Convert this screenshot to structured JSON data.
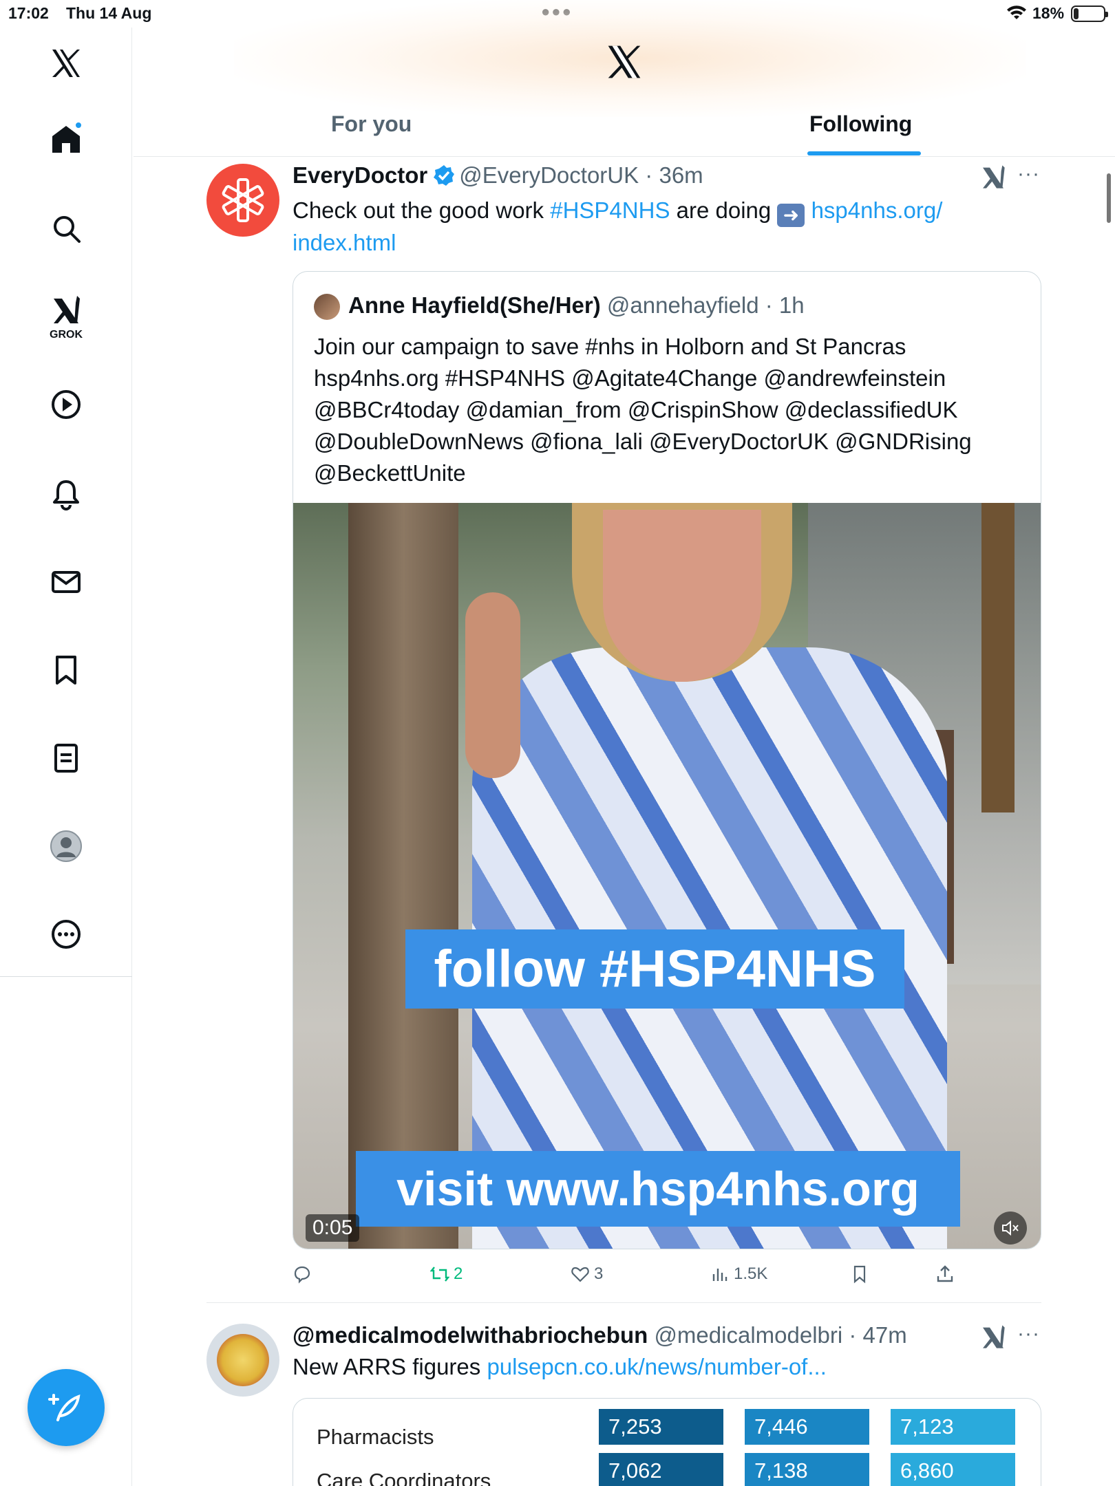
{
  "status_bar": {
    "time": "17:02",
    "date": "Thu 14 Aug",
    "battery": "18%"
  },
  "sidebar": {
    "items": [
      {
        "name": "x-logo"
      },
      {
        "name": "home"
      },
      {
        "name": "search"
      },
      {
        "name": "grok",
        "label": "GROK"
      },
      {
        "name": "video"
      },
      {
        "name": "notifications"
      },
      {
        "name": "messages"
      },
      {
        "name": "bookmarks"
      },
      {
        "name": "lists"
      },
      {
        "name": "profile"
      },
      {
        "name": "more"
      }
    ]
  },
  "header": {
    "tabs": [
      {
        "label": "For you",
        "active": false
      },
      {
        "label": "Following",
        "active": true
      }
    ]
  },
  "tweet1": {
    "name": "EveryDoctor",
    "handle": "@EveryDoctorUK",
    "time": "36m",
    "text_before": "Check out the good work ",
    "hashtag": "#HSP4NHS",
    "text_mid": " are doing ",
    "link": "hsp4nhs.org/​index.html",
    "quote": {
      "name": "Anne Hayfield(She/Her)",
      "handle": "@annehayfield",
      "time": "1h",
      "text_lines": [
        "Join our campaign to save #nhs in Holborn and St Pancras",
        "hsp4nhs.org #HSP4NHS @Agitate4Change @andrewfeinstein",
        "@BBCr4today @damian_from @CrispinShow @declassifiedUK",
        "@DoubleDownNews @fiona_lali @EveryDoctorUK @GNDRising",
        "@BeckettUnite"
      ],
      "video": {
        "banner1": "follow #HSP4NHS",
        "banner2": "visit www.hsp4nhs.org",
        "duration": "0:05"
      }
    },
    "stats": {
      "retweets": "2",
      "likes": "3",
      "views": "1.5K"
    }
  },
  "tweet2": {
    "name": "@medicalmodelwithabriochebun",
    "handle": "@medicalmodelbri",
    "time": "47m",
    "text": "New ARRS figures ",
    "link": "pulsepcn.co.uk/news/number-of...",
    "table": {
      "rows": [
        {
          "label": "Pharmacists",
          "values": [
            "7,253",
            "7,446",
            "7,123"
          ]
        },
        {
          "label": "Care Coordinators",
          "values": [
            "7,062",
            "7,138",
            "6,860"
          ]
        }
      ],
      "colors": [
        "#0d5c8c",
        "#1a86c4",
        "#2aaadc"
      ]
    }
  },
  "colors": {
    "accent": "#1d9bf0",
    "everydoctor": "#f24b3d",
    "retweet": "#00ba7c"
  }
}
